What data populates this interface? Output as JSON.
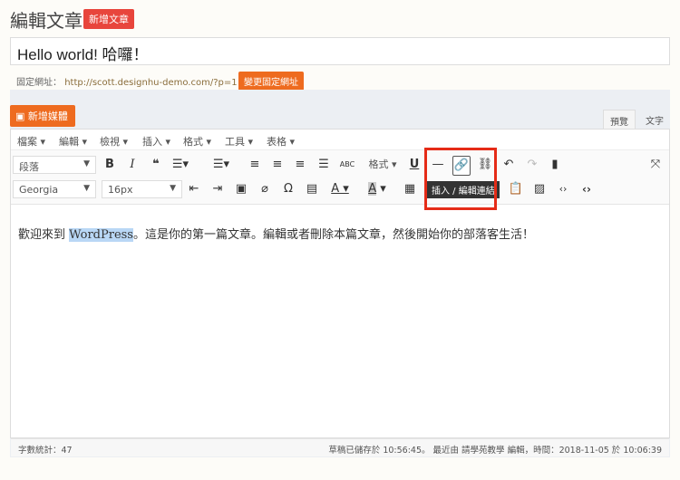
{
  "page": {
    "title": "編輯文章",
    "new_post": "新增文章"
  },
  "post": {
    "title": "Hello world! 哈囉！",
    "permalink_label": "固定網址：",
    "permalink_url": "http://scott.designhu-demo.com/?p=1",
    "change_permalink": "變更固定網址"
  },
  "editor": {
    "add_media": "新增媒體",
    "tabs": [
      "預覽",
      "文字"
    ],
    "menus": [
      "檔案 ▾",
      "編輯 ▾",
      "檢視 ▾",
      "插入 ▾",
      "格式 ▾",
      "工具 ▾",
      "表格 ▾"
    ],
    "block_format": "段落",
    "font_family": "Georgia",
    "font_size": "16px",
    "formats_label": "格式 ▾",
    "tooltip": "插入 / 編輯連結",
    "content_before": "歡迎來到 ",
    "content_highlight": "WordPress",
    "content_after": "。這是你的第一篇文章。編輯或者刪除本篇文章，然後開始你的部落客生活！"
  },
  "status": {
    "word_count": "字數統計：47",
    "saved": "草稿已儲存於 10:56:45。 最近由 請學苑教學 編輯，時間：2018-11-05 於 10:06:39"
  },
  "colors": {
    "accent": "#ee6b1f",
    "red": "#e8453c",
    "highlight_box": "#e52b17"
  }
}
